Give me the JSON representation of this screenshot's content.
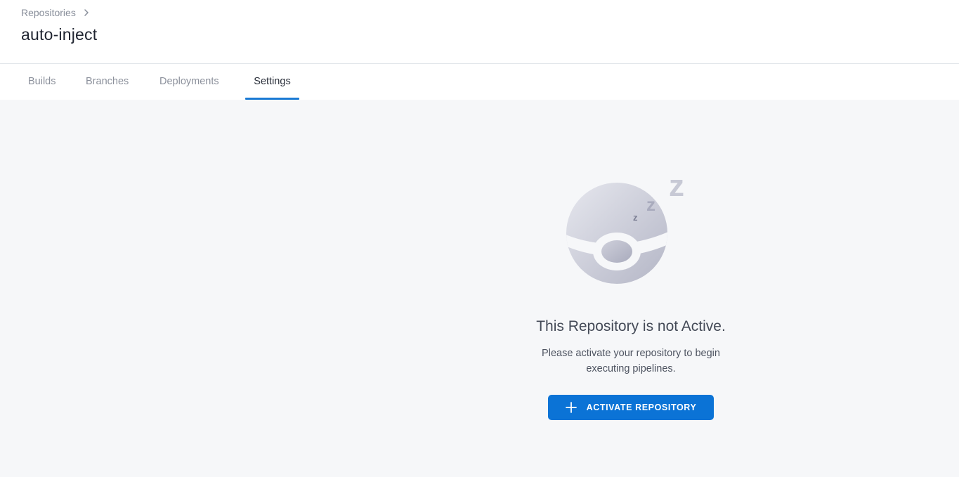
{
  "breadcrumb": {
    "parent_label": "Repositories"
  },
  "page": {
    "title": "auto-inject"
  },
  "tabs": [
    {
      "label": "Builds",
      "active": false
    },
    {
      "label": "Branches",
      "active": false
    },
    {
      "label": "Deployments",
      "active": false
    },
    {
      "label": "Settings",
      "active": true
    }
  ],
  "empty_state": {
    "illustration": "sleeping-ball-icon",
    "title": "This Repository is not Active.",
    "description": "Please activate your repository to begin executing pipelines.",
    "button_label": "ACTIVATE REPOSITORY",
    "button_icon": "plus-icon"
  },
  "colors": {
    "accent": "#0b73d6",
    "tab_underline": "#1a7ad4",
    "background": "#f6f7f9"
  }
}
